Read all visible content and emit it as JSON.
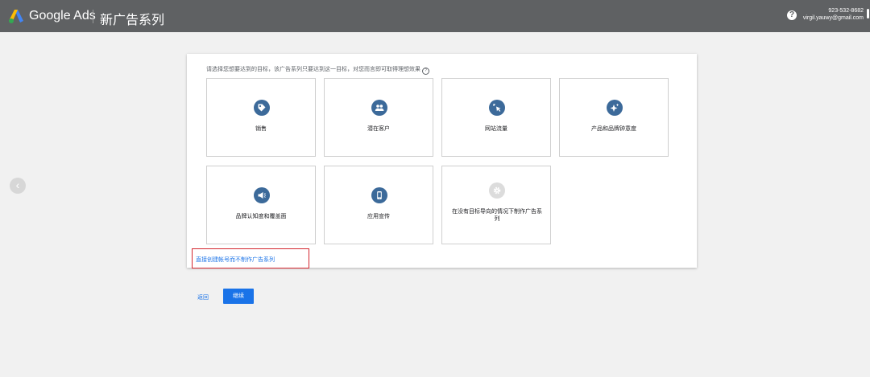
{
  "header": {
    "brand": "Google Ads",
    "page_title": "新广告系列",
    "help_icon": "?",
    "account_id": "923-532-8682",
    "account_email": "virgil.yauwy@gmail.com"
  },
  "goals": {
    "prompt": "请选择您想要达到的目标，该广告系列只要达到这一目标，对您而言即可取得理想效果",
    "tiles": [
      {
        "label": "销售",
        "icon": "tag-icon"
      },
      {
        "label": "潜在客户",
        "icon": "people-icon"
      },
      {
        "label": "网站流量",
        "icon": "cursor-click-icon"
      },
      {
        "label": "产品和品牌钟意度",
        "icon": "sparkle-icon"
      },
      {
        "label": "品牌认知度和覆盖面",
        "icon": "megaphone-icon"
      },
      {
        "label": "应用宣传",
        "icon": "phone-icon"
      },
      {
        "label": "在没有目标导向的情况下制作广告系列",
        "icon": "gear-icon"
      }
    ],
    "skip_link": "直接创建帐号而不制作广告系列"
  },
  "footer": {
    "back_label": "返回",
    "continue_label": "继续"
  },
  "nav": {
    "prev_icon": "‹"
  },
  "colors": {
    "topbar": "#5f6163",
    "icon_blue": "#3c6a9a",
    "primary": "#1a73e8",
    "highlight": "#d4262e"
  }
}
